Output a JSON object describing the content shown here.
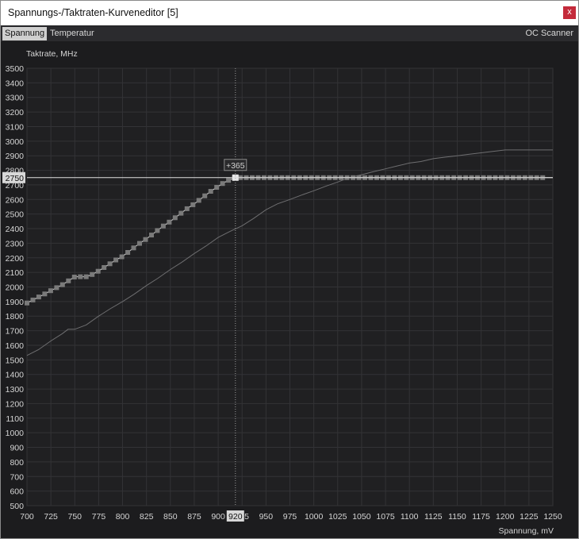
{
  "window": {
    "title": "Spannungs-/Taktraten-Kurveneditor [5]",
    "close_label": "x"
  },
  "tabs": {
    "voltage": "Spannung",
    "temperature": "Temperatur",
    "oc_scanner": "OC Scanner"
  },
  "chart_data": {
    "type": "line",
    "ylabel": "Taktrate, MHz",
    "xlabel": "Spannung, mV",
    "xlim": [
      700,
      1250
    ],
    "ylim": [
      500,
      3500
    ],
    "x_ticks": [
      700,
      725,
      750,
      775,
      800,
      825,
      850,
      875,
      900,
      925,
      950,
      975,
      1000,
      1025,
      1050,
      1075,
      1100,
      1125,
      1150,
      1175,
      1200,
      1225,
      1250
    ],
    "y_ticks": [
      500,
      600,
      700,
      800,
      900,
      1000,
      1100,
      1200,
      1300,
      1400,
      1500,
      1600,
      1700,
      1800,
      1900,
      2000,
      2100,
      2200,
      2300,
      2400,
      2500,
      2600,
      2700,
      2800,
      2900,
      3000,
      3100,
      3200,
      3300,
      3400,
      3500
    ],
    "grid": true,
    "cursor": {
      "x_label": "920",
      "y_label": "2750",
      "offset_label": "+365",
      "x": 918,
      "y": 2750
    },
    "series": [
      {
        "role": "edited-curve",
        "x": [
          700,
          706,
          712,
          718,
          725,
          731,
          737,
          743,
          750,
          756,
          762,
          768,
          775,
          781,
          787,
          793,
          800,
          806,
          812,
          818,
          825,
          831,
          837,
          843,
          850,
          856,
          862,
          868,
          875,
          881,
          887,
          893,
          900,
          906,
          912,
          918,
          1250
        ],
        "y": [
          1890,
          1910,
          1930,
          1950,
          1975,
          1995,
          2015,
          2040,
          2070,
          2070,
          2070,
          2085,
          2110,
          2135,
          2160,
          2185,
          2210,
          2240,
          2270,
          2300,
          2330,
          2360,
          2390,
          2420,
          2450,
          2480,
          2510,
          2540,
          2570,
          2600,
          2630,
          2660,
          2690,
          2715,
          2735,
          2750,
          2750
        ]
      },
      {
        "role": "default-curve",
        "x": [
          700,
          712,
          725,
          737,
          743,
          750,
          762,
          775,
          787,
          800,
          812,
          825,
          837,
          850,
          862,
          875,
          887,
          900,
          912,
          925,
          937,
          950,
          962,
          975,
          987,
          1000,
          1012,
          1025,
          1037,
          1050,
          1062,
          1075,
          1087,
          1100,
          1112,
          1125,
          1137,
          1150,
          1162,
          1175,
          1187,
          1200,
          1212,
          1225,
          1237,
          1250
        ],
        "y": [
          1530,
          1570,
          1630,
          1680,
          1710,
          1710,
          1740,
          1800,
          1850,
          1900,
          1950,
          2010,
          2060,
          2120,
          2170,
          2230,
          2280,
          2340,
          2380,
          2420,
          2470,
          2530,
          2570,
          2600,
          2630,
          2660,
          2690,
          2720,
          2750,
          2770,
          2790,
          2810,
          2830,
          2850,
          2860,
          2880,
          2890,
          2900,
          2910,
          2920,
          2930,
          2940,
          2940,
          2940,
          2940,
          2940
        ]
      }
    ]
  }
}
